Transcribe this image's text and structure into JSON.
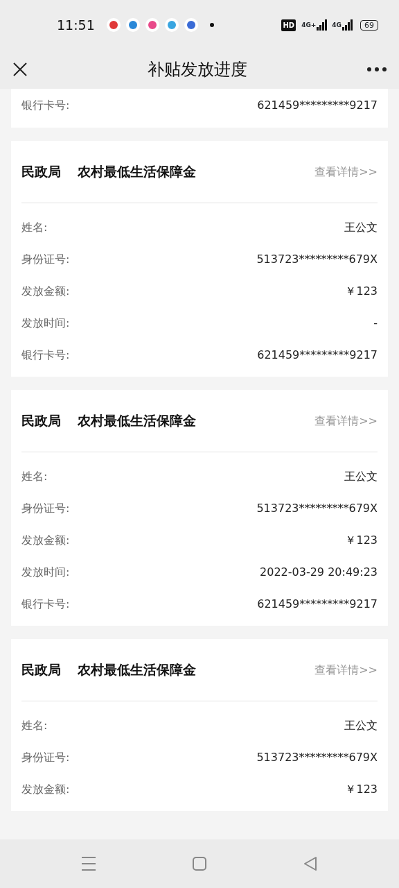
{
  "status_bar": {
    "time": "11:51",
    "hd": "HD",
    "networks": [
      "4G+",
      "4G"
    ],
    "battery": "69"
  },
  "header": {
    "title": "补贴发放进度"
  },
  "partial_card": {
    "rows": [
      {
        "label": "银行卡号:",
        "value": "621459*********9217"
      }
    ]
  },
  "cards": [
    {
      "department": "民政局",
      "program": "农村最低生活保障金",
      "link": "查看详情>>",
      "rows": [
        {
          "label": "姓名:",
          "value": "王公文"
        },
        {
          "label": "身份证号:",
          "value": "513723*********679X"
        },
        {
          "label": "发放金额:",
          "value": "￥123"
        },
        {
          "label": "发放时间:",
          "value": "-"
        },
        {
          "label": "银行卡号:",
          "value": "621459*********9217"
        }
      ]
    },
    {
      "department": "民政局",
      "program": "农村最低生活保障金",
      "link": "查看详情>>",
      "rows": [
        {
          "label": "姓名:",
          "value": "王公文"
        },
        {
          "label": "身份证号:",
          "value": "513723*********679X"
        },
        {
          "label": "发放金额:",
          "value": "￥123"
        },
        {
          "label": "发放时间:",
          "value": "2022-03-29 20:49:23"
        },
        {
          "label": "银行卡号:",
          "value": "621459*********9217"
        }
      ]
    },
    {
      "department": "民政局",
      "program": "农村最低生活保障金",
      "link": "查看详情>>",
      "rows": [
        {
          "label": "姓名:",
          "value": "王公文"
        },
        {
          "label": "身份证号:",
          "value": "513723*********679X"
        },
        {
          "label": "发放金额:",
          "value": "￥123"
        }
      ]
    }
  ]
}
